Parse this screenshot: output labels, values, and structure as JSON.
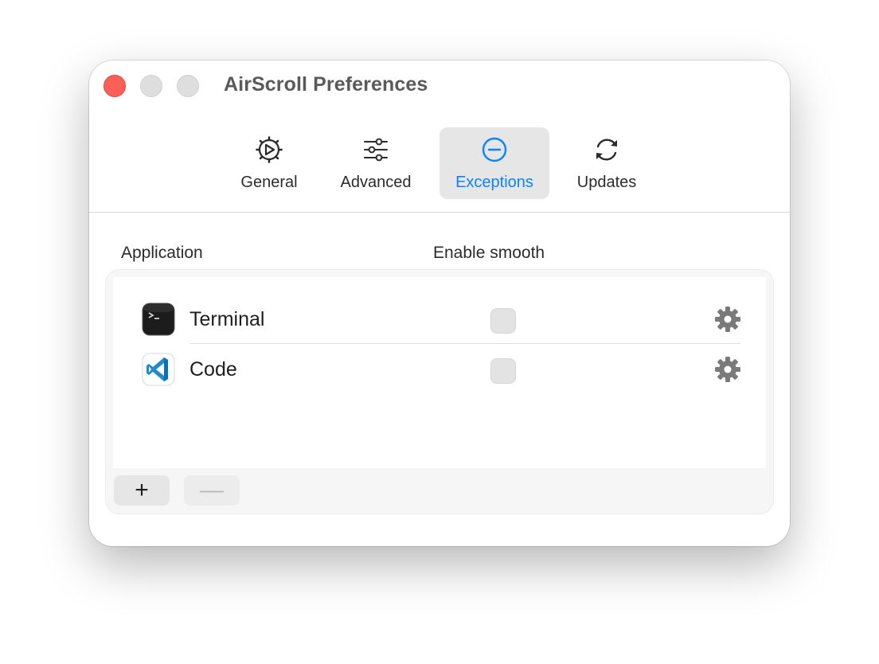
{
  "window": {
    "title": "AirScroll Preferences"
  },
  "toolbar": {
    "tabs": [
      {
        "label": "General",
        "icon": "general-icon"
      },
      {
        "label": "Advanced",
        "icon": "sliders-icon"
      },
      {
        "label": "Exceptions",
        "icon": "minus-circle-icon",
        "selected": true
      },
      {
        "label": "Updates",
        "icon": "sync-icon"
      }
    ],
    "accent_color": "#0a84ff"
  },
  "table": {
    "headers": {
      "application": "Application",
      "enable_smooth": "Enable smooth"
    },
    "rows": [
      {
        "name": "Terminal",
        "icon": "terminal-app-icon",
        "enable_smooth": false
      },
      {
        "name": "Code",
        "icon": "vscode-app-icon",
        "enable_smooth": false
      }
    ]
  },
  "buttons": {
    "add": "+",
    "remove": "—"
  }
}
